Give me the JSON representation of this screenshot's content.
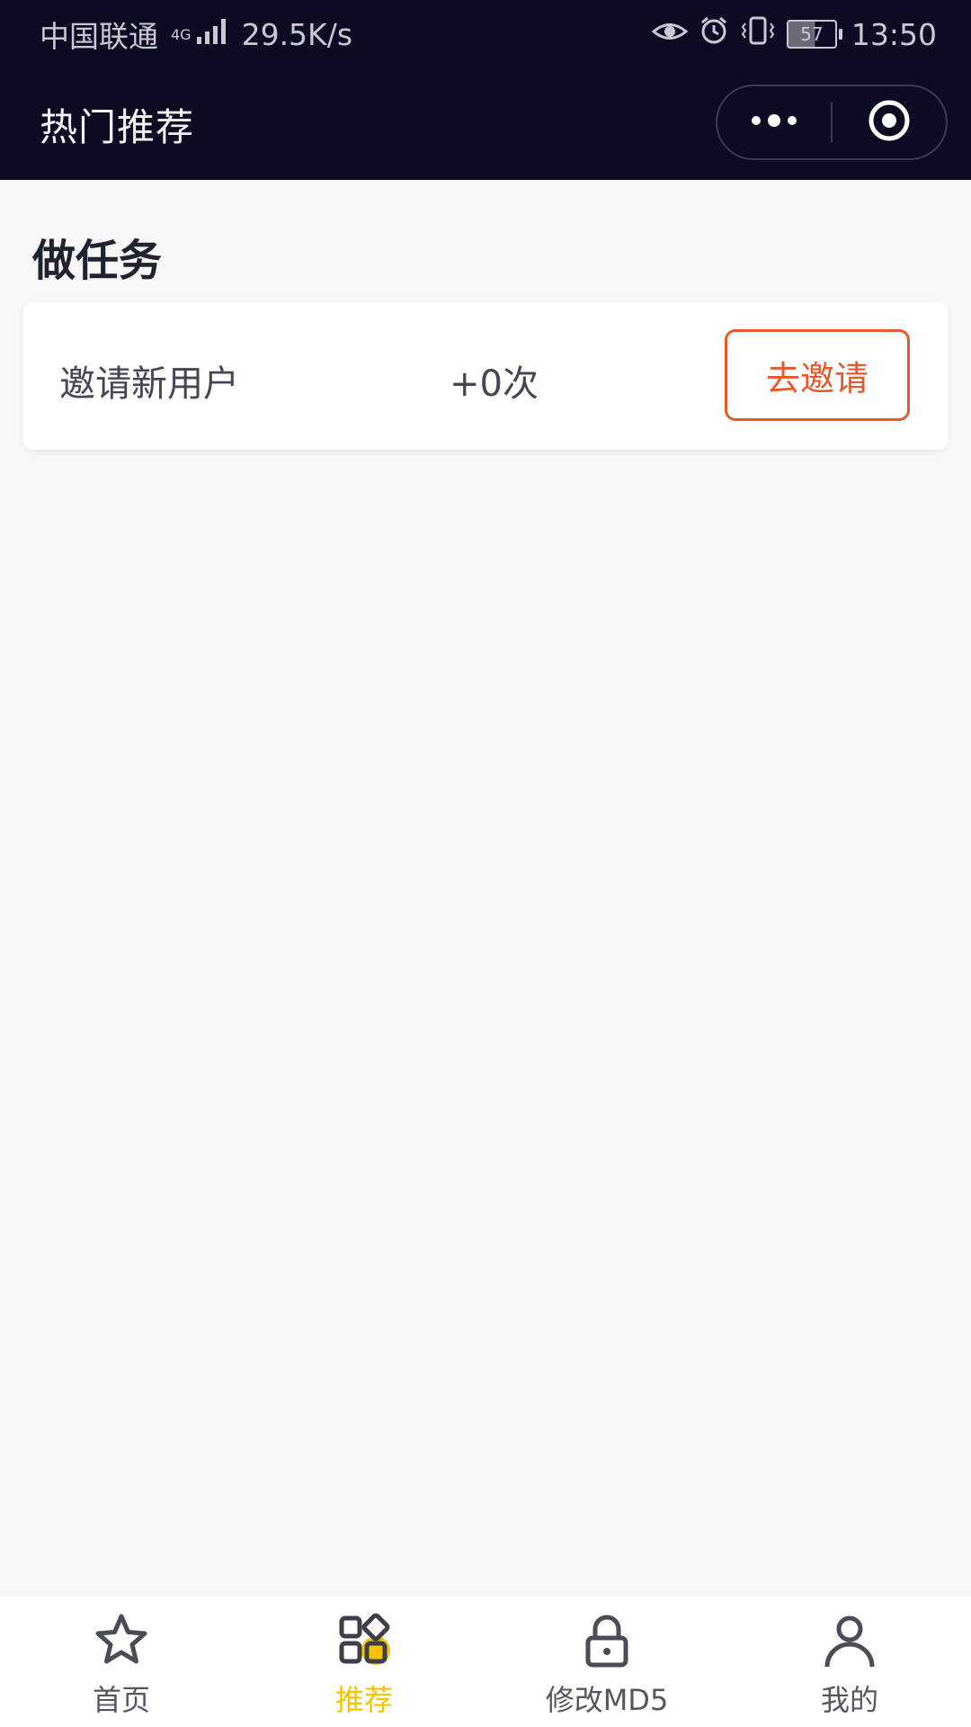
{
  "status_bar": {
    "carrier": "中国联通",
    "network": "4G",
    "speed": "29.5K/s",
    "battery": "57",
    "time": "13:50"
  },
  "navbar": {
    "title": "热门推荐"
  },
  "section": {
    "title": "做任务"
  },
  "task": {
    "name": "邀请新用户",
    "count": "+0次",
    "button_label": "去邀请"
  },
  "tabbar": {
    "items": [
      {
        "label": "首页",
        "icon": "star-icon"
      },
      {
        "label": "推荐",
        "icon": "grid-icon",
        "active": true
      },
      {
        "label": "修改MD5",
        "icon": "lock-icon"
      },
      {
        "label": "我的",
        "icon": "person-icon"
      }
    ]
  },
  "colors": {
    "header_bg": "#0b0b24",
    "accent_orange": "#e55a2b",
    "accent_yellow": "#f5c400",
    "page_bg": "#f7f7f7"
  }
}
